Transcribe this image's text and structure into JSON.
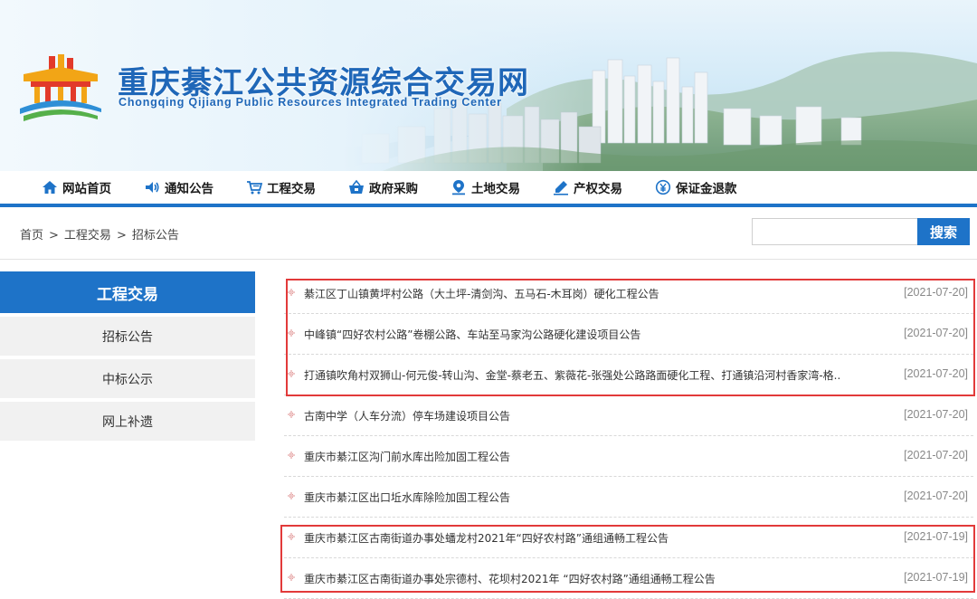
{
  "header": {
    "title": "重庆綦江公共资源综合交易网",
    "subtitle": "Chongqing Qijiang Public Resources Integrated Trading Center"
  },
  "nav": {
    "items": [
      {
        "label": "网站首页",
        "icon": "home-icon"
      },
      {
        "label": "通知公告",
        "icon": "speaker-icon"
      },
      {
        "label": "工程交易",
        "icon": "cart-icon"
      },
      {
        "label": "政府采购",
        "icon": "basket-icon"
      },
      {
        "label": "土地交易",
        "icon": "location-pin-icon"
      },
      {
        "label": "产权交易",
        "icon": "pen-icon"
      },
      {
        "label": "保证金退款",
        "icon": "yen-coin-icon"
      }
    ]
  },
  "breadcrumb": {
    "home": "首页",
    "section": "工程交易",
    "current": "招标公告",
    "separator": ">"
  },
  "search": {
    "placeholder": "",
    "button_label": "搜索"
  },
  "sidebar": {
    "heading": "工程交易",
    "items": [
      {
        "label": "招标公告"
      },
      {
        "label": "中标公示"
      },
      {
        "label": "网上补遗"
      }
    ]
  },
  "list": {
    "items": [
      {
        "title": "綦江区丁山镇黄坪村公路（大土坪-清剑沟、五马石-木耳岗）硬化工程公告",
        "date": "[2021-07-20]"
      },
      {
        "title": "中峰镇“四好农村公路”卷棚公路、车站至马家沟公路硬化建设项目公告",
        "date": "[2021-07-20]"
      },
      {
        "title": "打通镇吹角村双狮山-何元俊-转山沟、金堂-蔡老五、紫薇花-张强处公路路面硬化工程、打通镇沿河村香家湾-格..",
        "date": "[2021-07-20]"
      },
      {
        "title": "古南中学（人车分流）停车场建设项目公告",
        "date": "[2021-07-20]"
      },
      {
        "title": "重庆市綦江区沟门前水库出险加固工程公告",
        "date": "[2021-07-20]"
      },
      {
        "title": "重庆市綦江区出口坵水库除险加固工程公告",
        "date": "[2021-07-20]"
      },
      {
        "title": "重庆市綦江区古南街道办事处蟠龙村2021年“四好农村路”通组通畅工程公告",
        "date": "[2021-07-19]"
      },
      {
        "title": "重庆市綦江区古南街道办事处宗德村、花坝村2021年 “四好农村路”通组通畅工程公告",
        "date": "[2021-07-19]"
      }
    ]
  },
  "colors": {
    "brand_blue": "#1e73c8",
    "highlight_red": "#e23a3a",
    "date_gray": "#888888"
  }
}
